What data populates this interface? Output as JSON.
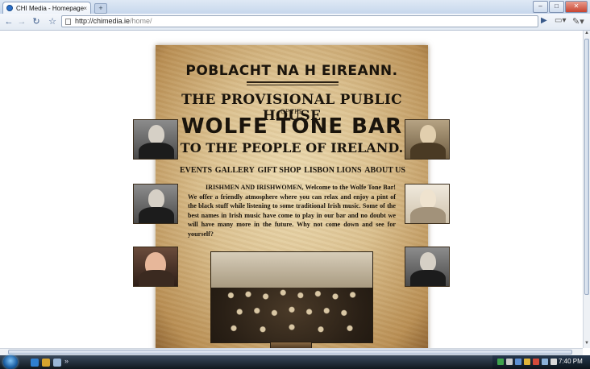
{
  "browser": {
    "tab_title": "CHI Media - Homepage",
    "tab_close": "×",
    "new_tab": "+",
    "url_host": "http://chimedia.ie",
    "url_path": "/home/",
    "back": "←",
    "forward": "→",
    "reload": "↻",
    "star": "☆",
    "go": "▶",
    "page_menu": "▭▾",
    "wrench": "✎▾",
    "minimize": "–",
    "maximize": "□",
    "close": "✕"
  },
  "poster": {
    "line1": "POBLACHT NA H EIREANN.",
    "line2": "THE PROVISIONAL PUBLIC HOUSE",
    "line3": "OF THE",
    "line4": "WOLFE TONE BAR",
    "line5": "TO THE PEOPLE OF IRELAND.",
    "nav": [
      "EVENTS",
      "GALLERY",
      "GIFT SHOP",
      "LISBON LIONS",
      "ABOUT US"
    ],
    "intro": "IRISHMEN AND IRISHWOMEN, Welcome to the Wolfe Tone Bar! We offer a friendly atmosphere where you can relax and enjoy a pint of the black stuff while listening to some traditional Irish music. Some of the best names in Irish music have come to play in our bar and no doubt we will have many more in the future. Why not come down and see for yourself?"
  },
  "taskbar": {
    "clock": "7:40 PM",
    "overflow": "»"
  },
  "colors": {
    "parchment": "#dcc291",
    "ink": "#1a140c",
    "taskbar": "#10181f"
  }
}
